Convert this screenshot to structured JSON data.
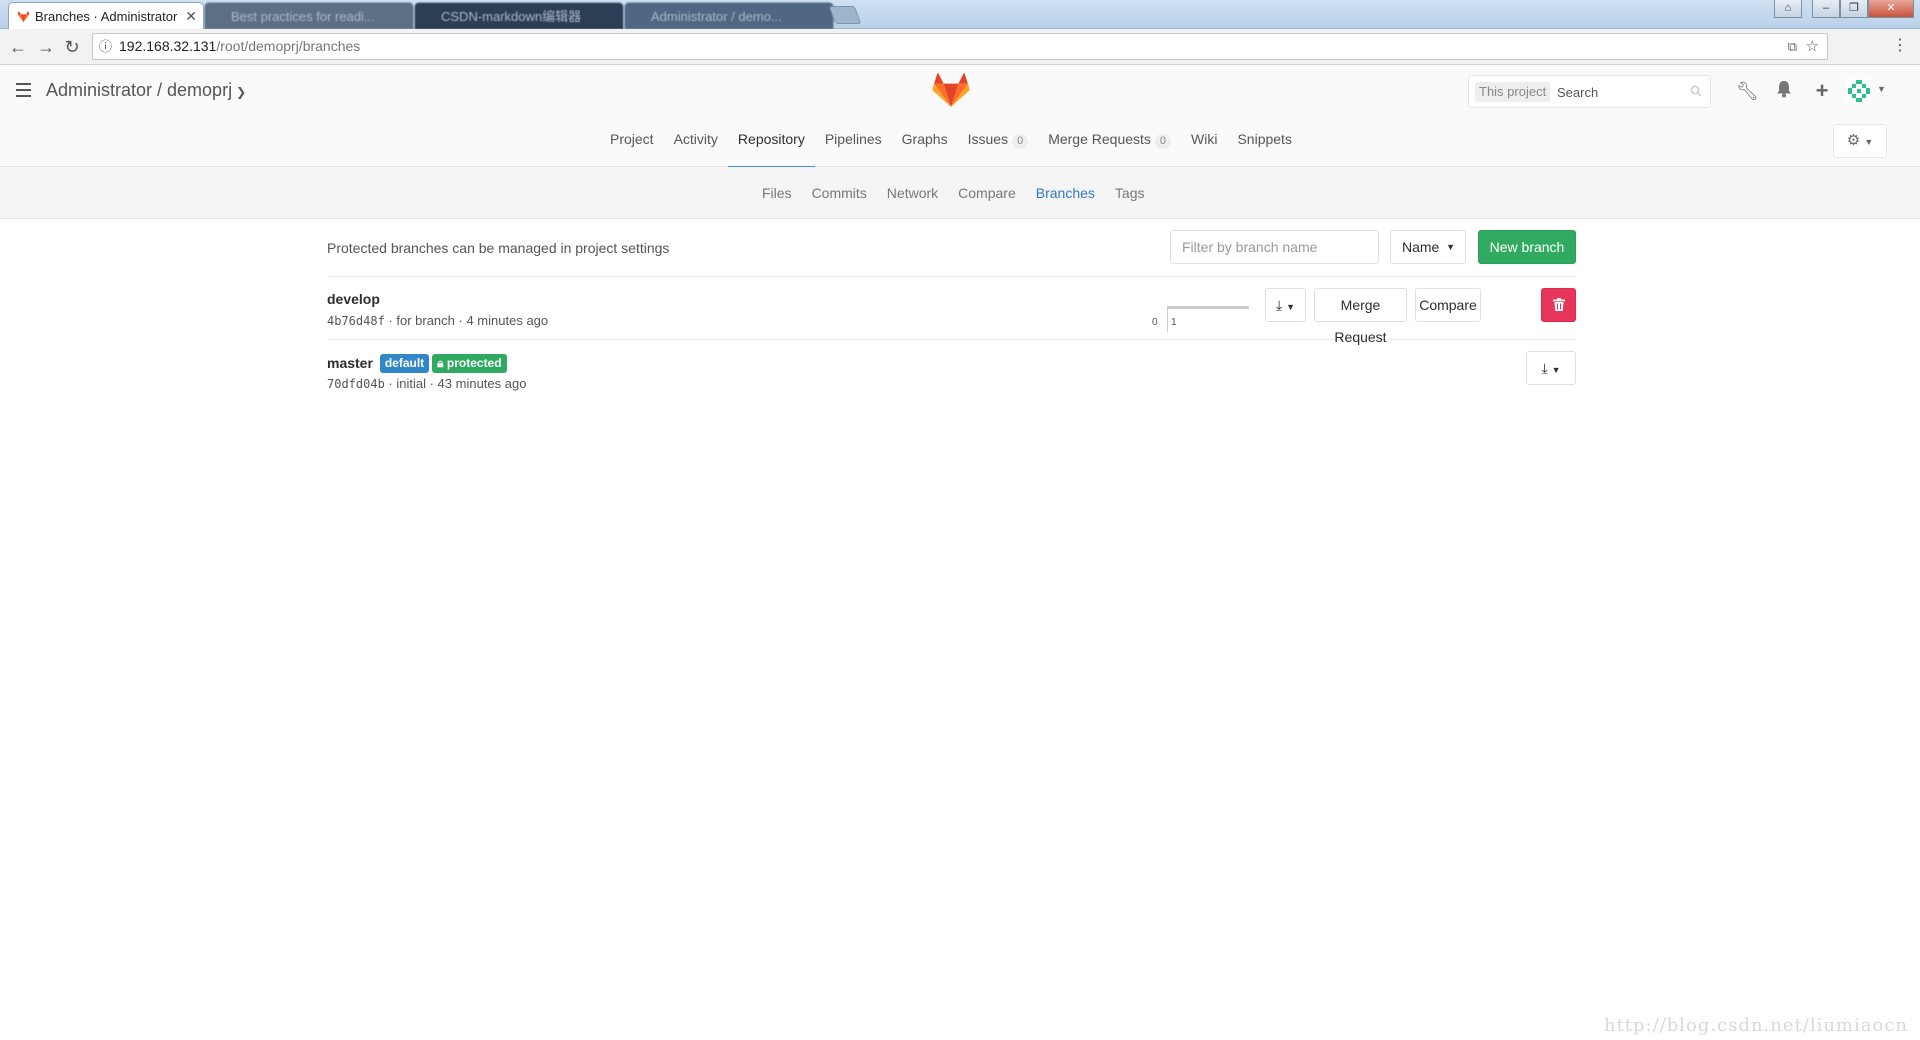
{
  "browser": {
    "active_tab_title": "Branches · Administrator",
    "background_tabs": [
      "Best practices for readi...",
      "CSDN-markdown编辑器",
      "Administrator / demo..."
    ],
    "url_host": "192.168.32.131",
    "url_path": "/root/demoprj/branches"
  },
  "header": {
    "breadcrumb": "Administrator / demoprj",
    "search_scope": "This project",
    "search_placeholder": "Search"
  },
  "project_nav": {
    "items": [
      {
        "label": "Project"
      },
      {
        "label": "Activity"
      },
      {
        "label": "Repository",
        "active": true
      },
      {
        "label": "Pipelines"
      },
      {
        "label": "Graphs"
      },
      {
        "label": "Issues",
        "count": "0"
      },
      {
        "label": "Merge Requests",
        "count": "0"
      },
      {
        "label": "Wiki"
      },
      {
        "label": "Snippets"
      }
    ]
  },
  "repo_nav": {
    "items": [
      "Files",
      "Commits",
      "Network",
      "Compare",
      "Branches",
      "Tags"
    ],
    "active": "Branches"
  },
  "branches_page": {
    "protected_note": "Protected branches can be managed in project settings",
    "filter_placeholder": "Filter by branch name",
    "sort_label": "Name",
    "new_branch_label": "New branch",
    "merge_request_label": "Merge Request",
    "compare_label": "Compare",
    "branches": [
      {
        "name": "develop",
        "sha": "4b76d48f",
        "message": "for branch",
        "time": "4 minutes ago",
        "behind": "0",
        "ahead": "1"
      },
      {
        "name": "master",
        "sha": "70dfd04b",
        "message": "initial",
        "time": "43 minutes ago",
        "labels": {
          "default": "default",
          "protected": "protected"
        }
      }
    ]
  },
  "watermark": "http://blog.csdn.net/liumiaocn",
  "colors": {
    "accent_blue": "#4a8bee",
    "link_blue": "#3079c4",
    "success_green": "#2faa60",
    "danger_red": "#e73559",
    "label_blue": "#3087c9",
    "gitlab_orange": "#e24329"
  }
}
